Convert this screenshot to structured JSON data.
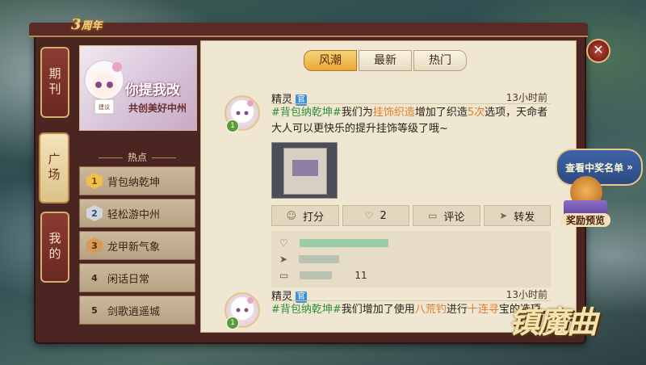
{
  "anniversary": {
    "number": "3",
    "suffix": "周年"
  },
  "side_tabs": [
    {
      "label": "期刊",
      "active": false
    },
    {
      "label": "广场",
      "active": true
    },
    {
      "label": "我的",
      "active": false
    }
  ],
  "banner": {
    "line1": "你提我改",
    "line2": "共创美好中州",
    "tag": "建议"
  },
  "hot": {
    "title": "热点",
    "items": [
      {
        "rank": "1",
        "label": "背包纳乾坤"
      },
      {
        "rank": "2",
        "label": "轻松游中州"
      },
      {
        "rank": "3",
        "label": "龙甲新气象"
      },
      {
        "rank": "4",
        "label": "闲话日常"
      },
      {
        "rank": "5",
        "label": "剑歌逍遥城"
      }
    ]
  },
  "top_tabs": [
    {
      "label": "风潮",
      "active": true
    },
    {
      "label": "最新",
      "active": false
    },
    {
      "label": "热门",
      "active": false
    }
  ],
  "posts": [
    {
      "author": "精灵",
      "badge": "官",
      "level": "1",
      "time": "13小时前",
      "segments": [
        {
          "text": "#背包纳乾坤#",
          "style": "g"
        },
        {
          "text": "我们为",
          "style": ""
        },
        {
          "text": "挂饰织造",
          "style": "o"
        },
        {
          "text": "增加了织造",
          "style": ""
        },
        {
          "text": "5次",
          "style": "o"
        },
        {
          "text": "选项，天命者大人可以更快乐的提升挂饰等级了哦~",
          "style": ""
        }
      ],
      "actions": {
        "rate": "打分",
        "likes": "2",
        "comment": "评论",
        "share": "转发"
      },
      "reply_count": "11"
    },
    {
      "author": "精灵",
      "badge": "官",
      "level": "1",
      "time": "13小时前",
      "segments": [
        {
          "text": "#背包纳乾坤#",
          "style": "g"
        },
        {
          "text": "我们增加了使用",
          "style": ""
        },
        {
          "text": "八荒钓",
          "style": "o"
        },
        {
          "text": "进行",
          "style": ""
        },
        {
          "text": "十连寻",
          "style": "o"
        },
        {
          "text": "宝的选项",
          "style": ""
        }
      ]
    }
  ],
  "right_float": {
    "rank_label": "查看中奖名单",
    "reward_label": "奖励预览"
  },
  "game_logo": "镇魔曲",
  "colors": {
    "accent": "#e9a93a",
    "hashtag": "#2f8f3a",
    "highlight": "#e27c2c",
    "frame": "#4b2521"
  }
}
